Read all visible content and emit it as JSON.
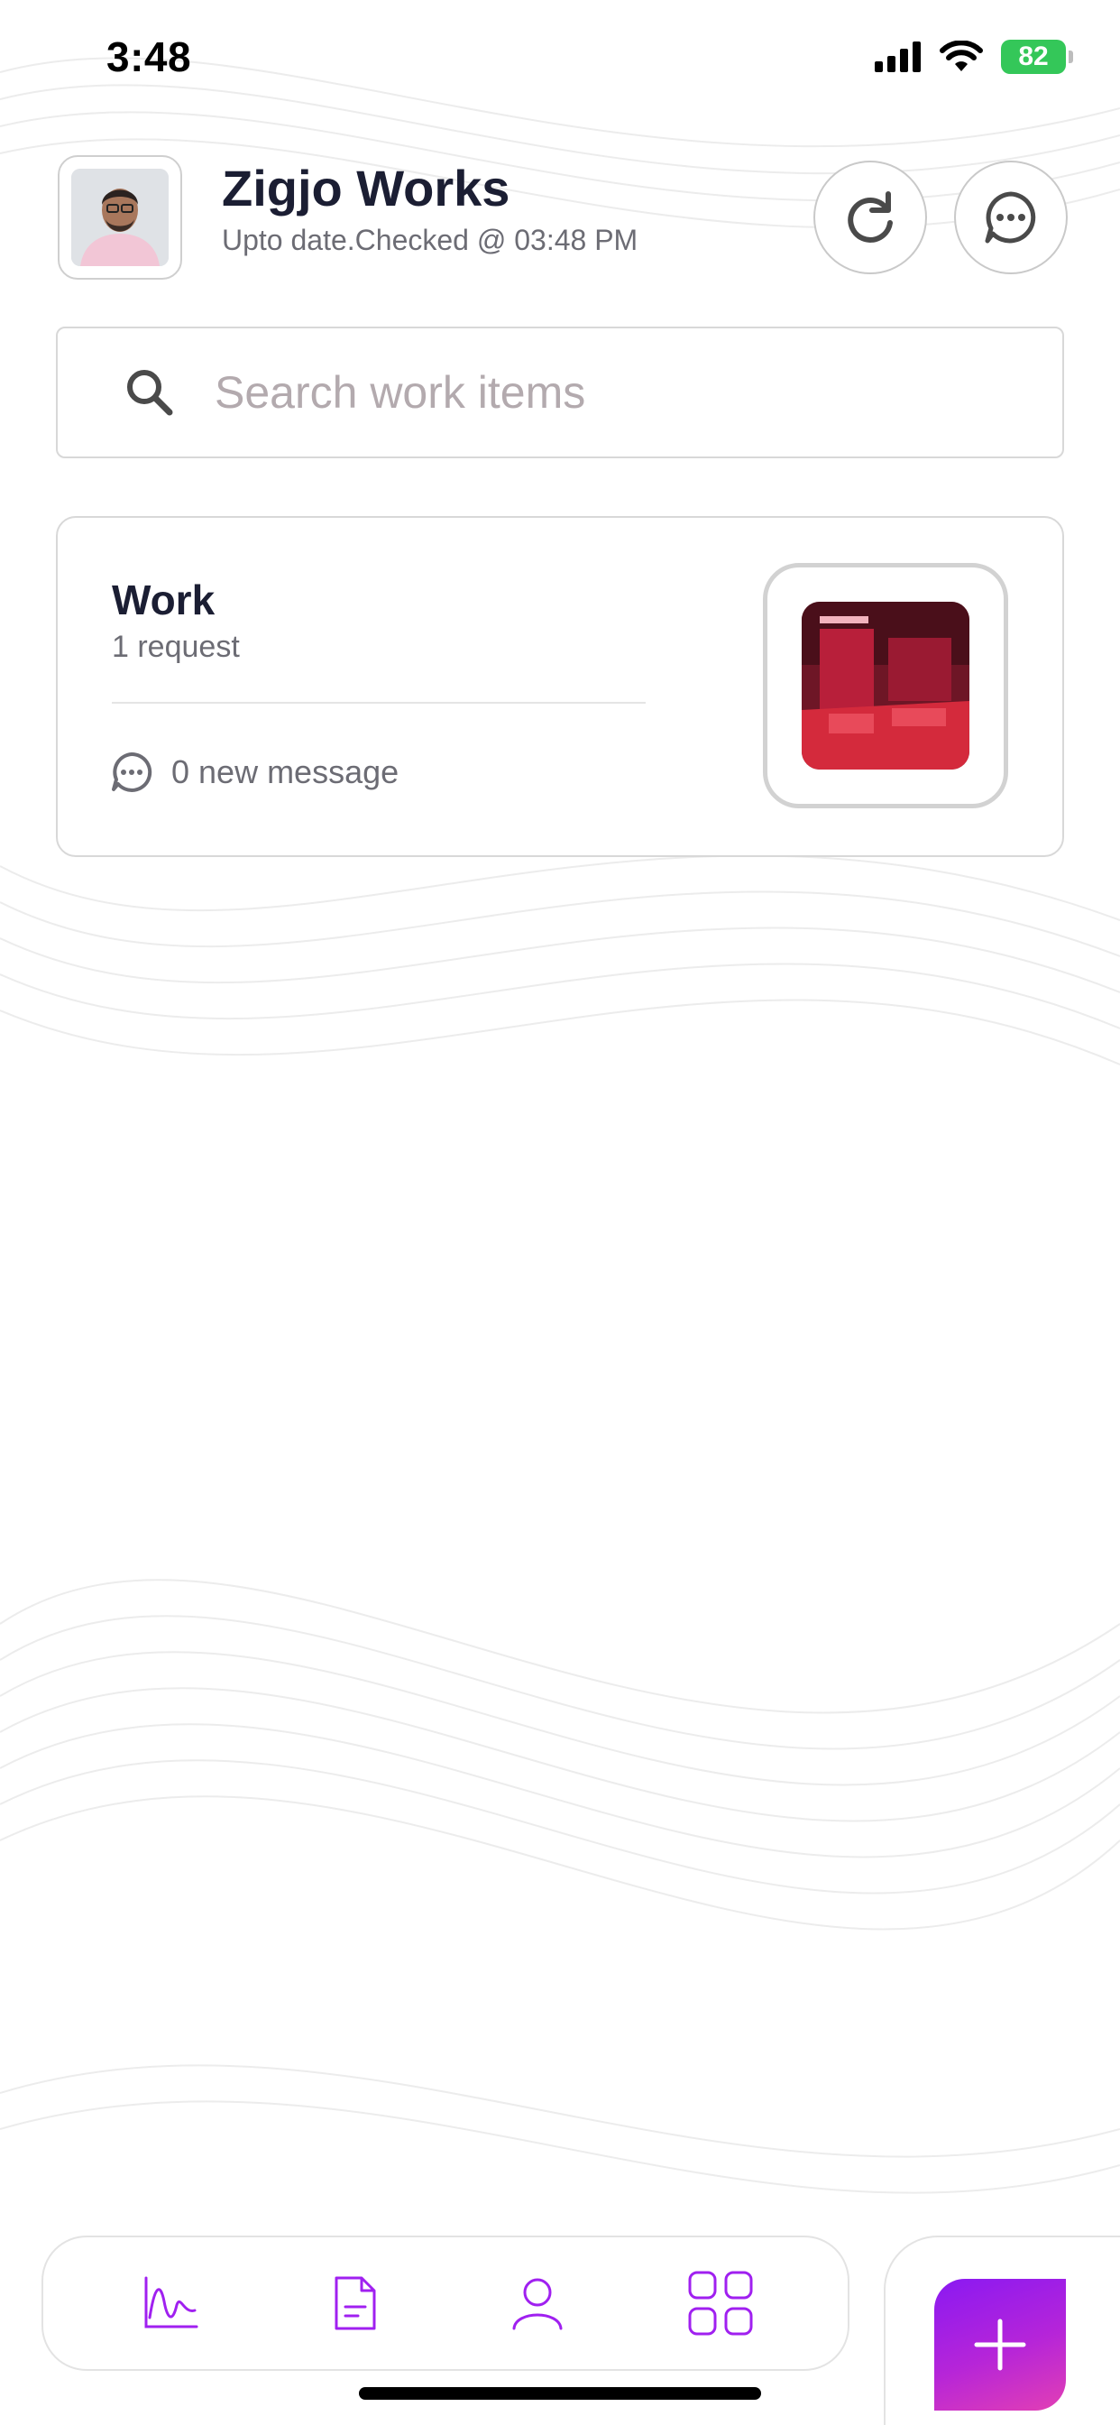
{
  "status_bar": {
    "time": "3:48",
    "battery": "82",
    "battery_color": "#34c759"
  },
  "header": {
    "title": "Zigjo Works",
    "subtitle": "Upto date.Checked @ 03:48 PM",
    "refresh_icon": "refresh-icon",
    "chat_icon": "chat-bubble-icon"
  },
  "search": {
    "placeholder": "Search work items",
    "icon": "search-icon"
  },
  "work_card": {
    "title": "Work",
    "requests": "1 request",
    "messages": "0 new message"
  },
  "bottom_nav": {
    "tabs": [
      {
        "icon": "activity-chart-icon"
      },
      {
        "icon": "document-icon"
      },
      {
        "icon": "person-icon"
      },
      {
        "icon": "apps-grid-icon"
      }
    ],
    "fab_icon": "plus-icon",
    "accent_color": "#a020f0"
  }
}
